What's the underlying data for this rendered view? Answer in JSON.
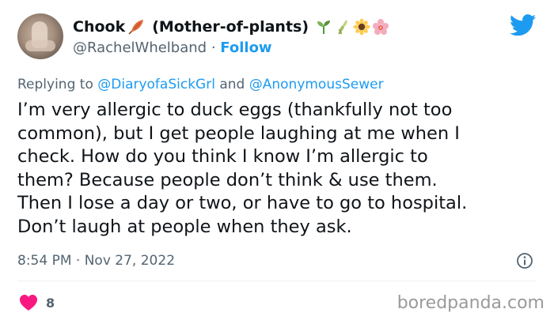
{
  "author": {
    "display_name": "Chook",
    "display_suffix": "(Mother-of-plants)",
    "handle": "@RachelWhelband",
    "separator": "·",
    "follow_label": "Follow"
  },
  "reply_context": {
    "prefix": "Replying to",
    "mention_1": "@DiaryofaSickGrl",
    "conjunction": "and",
    "mention_2": "@AnonymousSewer"
  },
  "tweet": {
    "lines": [
      "I’m very allergic to duck eggs (thankfully not too",
      "common), but I get people laughing at me when I",
      "check. How do you think I know I’m allergic to",
      "them? Because people don’t think & use them.",
      "Then I lose a day or two, or have to go to hospital.",
      "Don’t laugh at people when they ask."
    ],
    "time": "8:54 PM",
    "separator": "·",
    "date": "Nov 27, 2022"
  },
  "stats": {
    "likes": "8"
  },
  "watermark": "boredpanda.com",
  "icons": {
    "name_emoji": "feather-icon",
    "plant_emojis": [
      "seedling-icon",
      "herb-icon",
      "sunflower-icon",
      "blossom-icon"
    ],
    "logo": "twitter-bird-icon",
    "info": "info-icon",
    "like": "heart-icon"
  },
  "colors": {
    "link": "#1d9bf0",
    "secondary_text": "#536471",
    "primary_text": "#0f1419",
    "like": "#f91880",
    "watermark": "#9a9a9a"
  }
}
